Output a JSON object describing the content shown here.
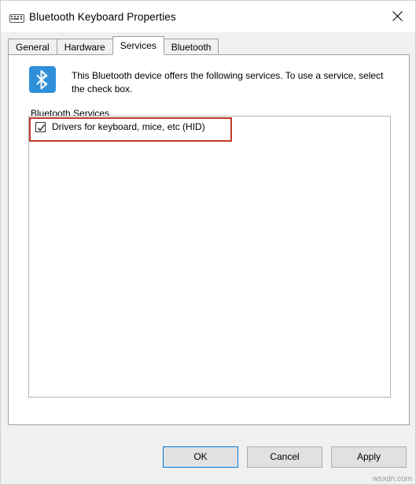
{
  "window": {
    "title": "Bluetooth Keyboard Properties",
    "title_icon": "keyboard-icon",
    "close_label": "✕"
  },
  "tabs": [
    {
      "label": "General",
      "active": false
    },
    {
      "label": "Hardware",
      "active": false
    },
    {
      "label": "Services",
      "active": true
    },
    {
      "label": "Bluetooth",
      "active": false
    }
  ],
  "main": {
    "bluetooth_icon": "bluetooth-icon",
    "description": "This Bluetooth device offers the following services. To use a service, select the check box.",
    "group_label": "Bluetooth Services",
    "services": [
      {
        "label": "Drivers for keyboard, mice, etc (HID)",
        "checked": true
      }
    ],
    "highlight_color": "#c0392b"
  },
  "buttons": {
    "ok": "OK",
    "cancel": "Cancel",
    "apply": "Apply"
  },
  "watermark": "wsxdn.com"
}
